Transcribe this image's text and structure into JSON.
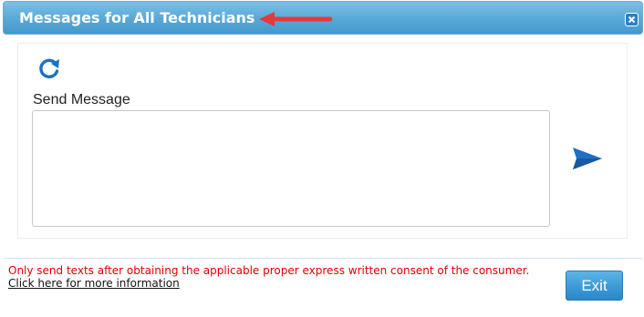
{
  "dialog": {
    "title": "Messages for All Technicians",
    "close_icon": "close-icon"
  },
  "annotation": {
    "color": "#e8383d",
    "icon": "arrow-left-icon"
  },
  "panel": {
    "refresh_icon": "refresh-icon",
    "send_label": "Send Message",
    "message_value": "",
    "send_icon": "send-icon"
  },
  "footer": {
    "consent_text": "Only send texts after obtaining the applicable proper express written consent of the consumer.",
    "info_link": "Click here for more information",
    "exit_label": "Exit"
  },
  "colors": {
    "title_bar": "#5aaad8",
    "accent": "#1f6fc5",
    "warning": "#e00000",
    "exit_button": "#3d9ad6"
  }
}
